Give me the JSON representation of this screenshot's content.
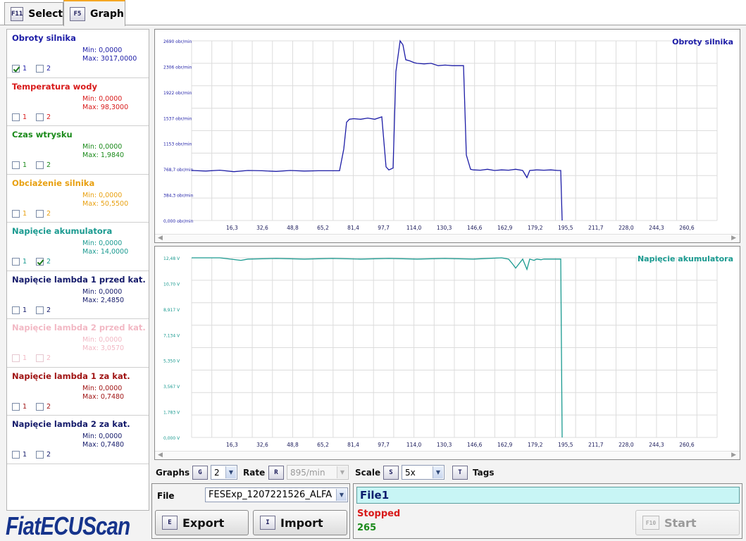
{
  "tabs": [
    {
      "key": "F11",
      "label": "Select"
    },
    {
      "key": "F5",
      "label": "Graph"
    }
  ],
  "channels": [
    {
      "name": "Obroty silnika",
      "min": "Min: 0,0000",
      "max": "Max: 3017,0000",
      "color": "#1c1ca6",
      "cb1": true,
      "cb2": false
    },
    {
      "name": "Temperatura wody",
      "min": "Min: 0,0000",
      "max": "Max: 98,3000",
      "color": "#d81a1a",
      "cb1": false,
      "cb2": false
    },
    {
      "name": "Czas wtrysku",
      "min": "Min: 0,0000",
      "max": "Max: 1,9840",
      "color": "#1a8a1a",
      "cb1": false,
      "cb2": false
    },
    {
      "name": "Obciażenie silnika",
      "min": "Min: 0,0000",
      "max": "Max: 50,5500",
      "color": "#e8a010",
      "cb1": false,
      "cb2": false
    },
    {
      "name": "Napięcie akumulatora",
      "min": "Min: 0,0000",
      "max": "Max: 14,0000",
      "color": "#1a9a90",
      "cb1": false,
      "cb2": true
    },
    {
      "name": "Napięcie lambda 1 przed kat.",
      "min": "Min: 0,0000",
      "max": "Max: 2,4850",
      "color": "#141a6a",
      "cb1": false,
      "cb2": false
    },
    {
      "name": "Napięcie lambda 2 przed kat.",
      "min": "Min: 0,0000",
      "max": "Max: 3,0570",
      "color": "#f2b8c4",
      "cb1": false,
      "cb2": false
    },
    {
      "name": "Napięcie lambda 1 za kat.",
      "min": "Min: 0,0000",
      "max": "Max: 0,7480",
      "color": "#a01414",
      "cb1": false,
      "cb2": false
    },
    {
      "name": "Napięcie lambda 2 za kat.",
      "min": "Min: 0,0000",
      "max": "Max: 0,7480",
      "color": "#141a6a",
      "cb1": false,
      "cb2": false
    }
  ],
  "cb_labels": [
    "1",
    "2"
  ],
  "logo": "FiatECUScan",
  "controls": {
    "graphs_label": "Graphs",
    "graphs_key": "G",
    "graphs_value": "2",
    "rate_label": "Rate",
    "rate_key": "R",
    "rate_value": "895/min",
    "scale_label": "Scale",
    "scale_key": "S",
    "scale_value": "5x",
    "tags_key": "T",
    "tags_label": "Tags"
  },
  "file": {
    "label": "File",
    "value": "FESExp_1207221526_ALFA",
    "export_key": "E",
    "export_label": "Export",
    "import_key": "I",
    "import_label": "Import"
  },
  "status": {
    "file_name": "File1",
    "state": "Stopped",
    "count": "265",
    "start_key": "F10",
    "start_label": "Start"
  },
  "chart_data": [
    {
      "type": "line",
      "title": "Obroty silnika",
      "color": "#1c1ca6",
      "x_ticks": [
        "16,3",
        "32,6",
        "48,8",
        "65,2",
        "81,4",
        "97,7",
        "114,0",
        "130,3",
        "146,6",
        "162,9",
        "179,2",
        "195,5",
        "211,7",
        "228,0",
        "244,3",
        "260,6"
      ],
      "y_ticks": [
        "0,000 obr/min",
        "384,3 obr/min",
        "768,7 obr/min",
        "1153 obr/min",
        "1537 obr/min",
        "1922 obr/min",
        "2306 obr/min",
        "2690 obr/min"
      ],
      "ylim": [
        0,
        3017
      ],
      "xlim": [
        0,
        373
      ],
      "x": [
        0,
        10,
        20,
        30,
        40,
        50,
        60,
        70,
        80,
        90,
        100,
        105,
        108,
        110,
        112,
        115,
        120,
        125,
        130,
        135,
        138,
        140,
        143,
        145,
        148,
        150,
        152,
        155,
        158,
        160,
        165,
        170,
        175,
        180,
        185,
        190,
        193,
        195,
        198,
        200,
        205,
        210,
        215,
        220,
        225,
        230,
        235,
        238,
        240,
        245,
        250,
        255,
        260,
        262,
        263
      ],
      "y": [
        840,
        830,
        845,
        820,
        840,
        835,
        825,
        840,
        830,
        835,
        835,
        835,
        1200,
        1650,
        1700,
        1710,
        1700,
        1720,
        1700,
        1740,
        900,
        850,
        880,
        2500,
        3017,
        2950,
        2700,
        2680,
        2650,
        2640,
        2630,
        2640,
        2600,
        2610,
        2600,
        2600,
        2600,
        1100,
        860,
        850,
        845,
        860,
        840,
        850,
        845,
        860,
        840,
        720,
        840,
        850,
        845,
        850,
        840,
        840,
        0
      ]
    },
    {
      "type": "line",
      "title": "Napięcie akumulatora",
      "color": "#1a9a90",
      "x_ticks": [
        "16,3",
        "32,6",
        "48,8",
        "65,2",
        "81,4",
        "97,7",
        "114,0",
        "130,3",
        "146,6",
        "162,9",
        "179,2",
        "195,5",
        "211,7",
        "228,0",
        "244,3",
        "260,6"
      ],
      "y_ticks": [
        "0,000 V",
        "1,783 V",
        "3,567 V",
        "5,350 V",
        "7,134 V",
        "8,917 V",
        "10,70 V",
        "12,48 V"
      ],
      "ylim": [
        0,
        14.0
      ],
      "xlim": [
        0,
        373
      ],
      "x": [
        0,
        20,
        35,
        40,
        60,
        80,
        100,
        120,
        140,
        160,
        180,
        200,
        220,
        225,
        228,
        230,
        235,
        238,
        240,
        243,
        245,
        248,
        250,
        255,
        260,
        262,
        263
      ],
      "y": [
        14.0,
        14.0,
        13.8,
        13.9,
        13.95,
        13.9,
        13.95,
        13.9,
        13.95,
        13.9,
        13.95,
        13.9,
        14.0,
        13.9,
        13.5,
        13.2,
        13.9,
        13.1,
        13.9,
        13.8,
        13.9,
        13.85,
        13.9,
        13.9,
        13.9,
        13.9,
        0
      ]
    }
  ]
}
